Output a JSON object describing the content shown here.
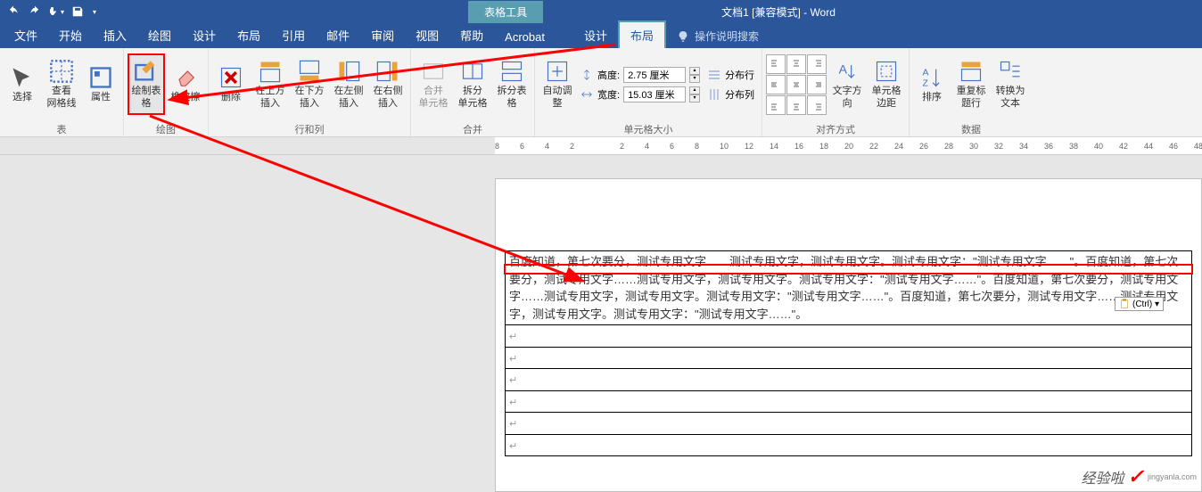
{
  "titleBar": {
    "contextLabel": "表格工具",
    "docTitle": "文档1 [兼容模式] - Word"
  },
  "tabs": {
    "file": "文件",
    "home": "开始",
    "insert": "插入",
    "draw": "绘图",
    "design": "设计",
    "layout": "布局",
    "references": "引用",
    "mailings": "邮件",
    "review": "审阅",
    "view": "视图",
    "help": "帮助",
    "acrobat": "Acrobat",
    "tableDesign": "设计",
    "tableLayout": "布局",
    "tellMe": "操作说明搜索"
  },
  "ribbon": {
    "table": {
      "select": "选择",
      "viewGridlines": "查看\n网格线",
      "properties": "属性",
      "groupLabel": "表"
    },
    "drawGroup": {
      "drawTable": "绘制表格",
      "eraser": "橡皮擦",
      "groupLabel": "绘图"
    },
    "rowsCols": {
      "delete": "删除",
      "insertAbove": "在上方插入",
      "insertBelow": "在下方插入",
      "insertLeft": "在左侧插入",
      "insertRight": "在右侧插入",
      "groupLabel": "行和列"
    },
    "merge": {
      "mergeCells": "合并\n单元格",
      "splitCells": "拆分\n单元格",
      "splitTable": "拆分表格",
      "groupLabel": "合并"
    },
    "cellSize": {
      "autofit": "自动调整",
      "heightLabel": "高度:",
      "heightValue": "2.75 厘米",
      "widthLabel": "宽度:",
      "widthValue": "15.03 厘米",
      "distRows": "分布行",
      "distCols": "分布列",
      "groupLabel": "单元格大小"
    },
    "alignment": {
      "textDirection": "文字方向",
      "cellMargins": "单元格\n边距",
      "groupLabel": "对齐方式"
    },
    "dataGroup": {
      "sort": "排序",
      "repeatHeader": "重复标题行",
      "convertToText": "转换为文本",
      "groupLabel": "数据"
    }
  },
  "ruler": {
    "ticks": [
      "8",
      "6",
      "4",
      "2",
      "",
      "2",
      "4",
      "6",
      "8",
      "10",
      "12",
      "14",
      "16",
      "18",
      "20",
      "22",
      "24",
      "26",
      "28",
      "30",
      "32",
      "34",
      "36",
      "38",
      "40",
      "42",
      "44",
      "46",
      "48"
    ]
  },
  "document": {
    "row1": "百度知道，第七次要分，测试专用文字……测试专用文字，测试专用文字。测试专用文字：\"测试专用文字……\"。百度知道，第七次要分，测试专用文字……测试专用文字，测试专用文字。测试专用文字：\"测试专用文字……\"。百度知道，第七次要分，测试专用文字……测试专用文字，测试专用文字。测试专用文字：\"测试专用文字……\"。百度知道，第七次要分，测试专用文字……测试专用文字，测试专用文字。测试专用文字：\"测试专用文字……\"。"
  },
  "pasteTag": "(Ctrl) ▾",
  "watermark": {
    "text": "经验啦",
    "sub": "jingyanla.com"
  }
}
